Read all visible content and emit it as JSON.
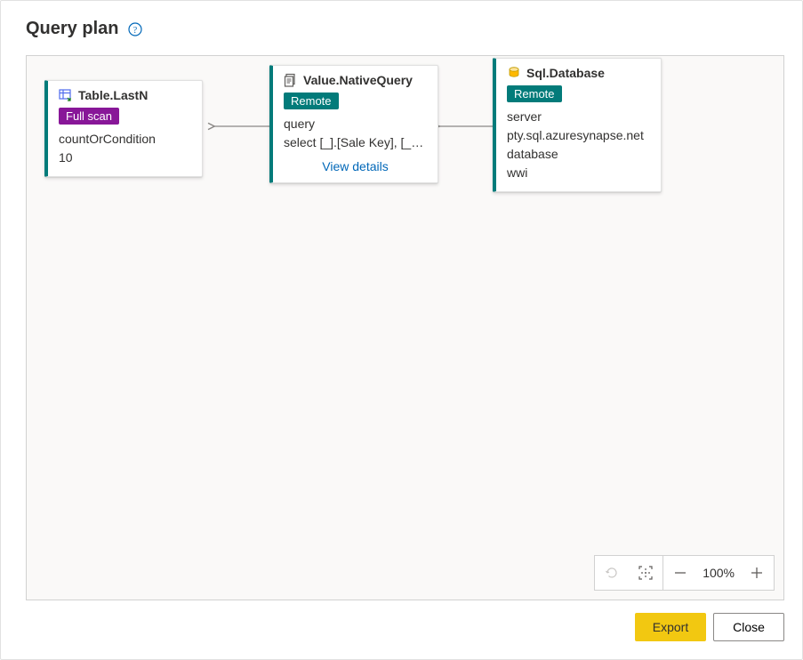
{
  "header": {
    "title": "Query plan"
  },
  "nodes": {
    "lastn": {
      "title": "Table.LastN",
      "badge": "Full scan",
      "prop_label": "countOrCondition",
      "prop_value": "10"
    },
    "nativequery": {
      "title": "Value.NativeQuery",
      "badge": "Remote",
      "prop_label": "query",
      "prop_value": "select [_].[Sale Key], [_]....",
      "link": "View details"
    },
    "sqldb": {
      "title": "Sql.Database",
      "badge": "Remote",
      "prop1_label": "server",
      "prop1_value": "pty.sql.azuresynapse.net",
      "prop2_label": "database",
      "prop2_value": "wwi"
    }
  },
  "toolbar": {
    "zoom": "100%"
  },
  "footer": {
    "export": "Export",
    "close": "Close"
  }
}
